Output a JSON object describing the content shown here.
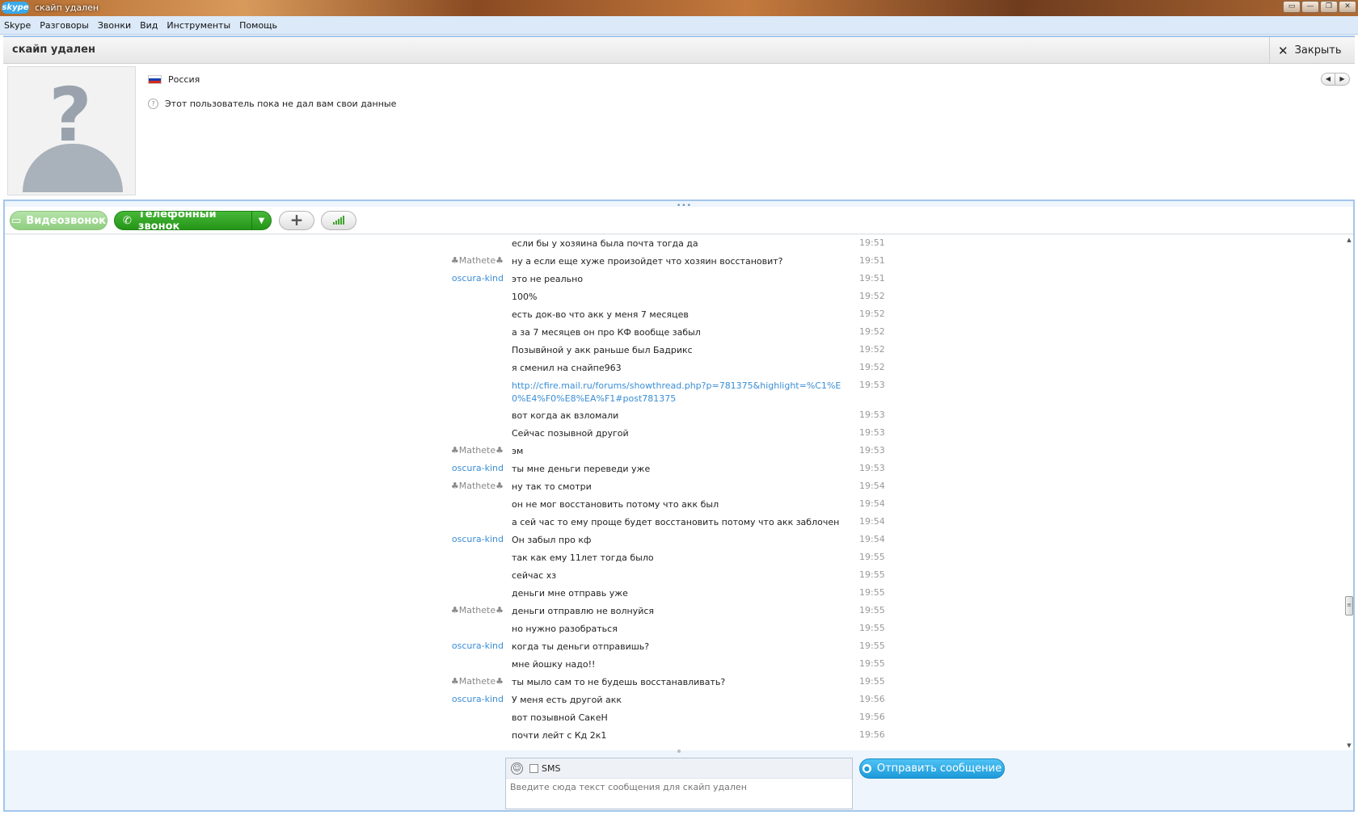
{
  "window": {
    "logo": "skype",
    "title": "скайп удален",
    "controls": [
      "▭",
      "—",
      "❐",
      "✕"
    ]
  },
  "menu": [
    "Skype",
    "Разговоры",
    "Звонки",
    "Вид",
    "Инструменты",
    "Помощь"
  ],
  "contact": {
    "name": "скайп удален",
    "close_label": "Закрыть",
    "country": "Россия",
    "info_note": "Этот пользователь пока не дал вам свои данные"
  },
  "toolbar": {
    "video_label": "Видеозвонок",
    "phone_label": "Телефонный звонок"
  },
  "messages": [
    {
      "author": "",
      "text": "если бы у хозяина была почта тогда да",
      "time": "19:51"
    },
    {
      "author": "♣Mathete♣",
      "text": "ну а если еще хуже произойдет что хозяин восстановит?",
      "time": "19:51"
    },
    {
      "author": "oscura-kind",
      "text": "это не реально",
      "time": "19:51"
    },
    {
      "author": "",
      "text": "100%",
      "time": "19:52"
    },
    {
      "author": "",
      "text": "есть док-во что акк у меня 7 месяцев",
      "time": "19:52"
    },
    {
      "author": "",
      "text": "а за 7 месяцев он про КФ вообще забыл",
      "time": "19:52"
    },
    {
      "author": "",
      "text": "Позывйной у акк раньше был Бадрикс",
      "time": "19:52"
    },
    {
      "author": "",
      "text": "я сменил на снайпе963",
      "time": "19:52"
    },
    {
      "author": "",
      "text": "http://cfire.mail.ru/forums/showthread.php?p=781375&highlight=%C1%E0%E4%F0%E8%EA%F1#post781375",
      "time": "19:53",
      "link": true
    },
    {
      "author": "",
      "text": "вот когда ак взломали",
      "time": "19:53"
    },
    {
      "author": "",
      "text": "Сейчас позывной другой",
      "time": "19:53"
    },
    {
      "author": "♣Mathete♣",
      "text": "эм",
      "time": "19:53"
    },
    {
      "author": "oscura-kind",
      "text": "ты мне деньги переведи уже",
      "time": "19:53"
    },
    {
      "author": "♣Mathete♣",
      "text": "ну так то смотри",
      "time": "19:54"
    },
    {
      "author": "",
      "text": "он не мог восстановить потому что акк был",
      "time": "19:54"
    },
    {
      "author": "",
      "text": "а сей час то ему проще будет восстановить потому что акк заблочен",
      "time": "19:54"
    },
    {
      "author": "oscura-kind",
      "text": "Он забыл про кф",
      "time": "19:54"
    },
    {
      "author": "",
      "text": "так как ему 11лет тогда было",
      "time": "19:55"
    },
    {
      "author": "",
      "text": "сейчас хз",
      "time": "19:55"
    },
    {
      "author": "",
      "text": "деньги мне отправь уже",
      "time": "19:55"
    },
    {
      "author": "♣Mathete♣",
      "text": "деньги отправлю не волнуйся",
      "time": "19:55"
    },
    {
      "author": "",
      "text": "но нужно разобраться",
      "time": "19:55"
    },
    {
      "author": "oscura-kind",
      "text": "когда ты деньги отправишь?",
      "time": "19:55"
    },
    {
      "author": "",
      "text": "мне йошку надо!!",
      "time": "19:55"
    },
    {
      "author": "♣Mathete♣",
      "text": "ты мыло сам то не будешь восстанавливать?",
      "time": "19:55"
    },
    {
      "author": "oscura-kind",
      "text": "У меня есть другой акк",
      "time": "19:56"
    },
    {
      "author": "",
      "text": "вот позывной СакеН",
      "time": "19:56"
    },
    {
      "author": "",
      "text": "почти лейт с Кд 2к1",
      "time": "19:56"
    }
  ],
  "compose": {
    "sms_label": "SMS",
    "placeholder": "Введите сюда текст сообщения для скайп удален",
    "send_label": "Отправить сообщение"
  },
  "colors": {
    "accent": "#3a8ed5",
    "call_green": "#239417",
    "send_blue": "#1c9ad9"
  }
}
